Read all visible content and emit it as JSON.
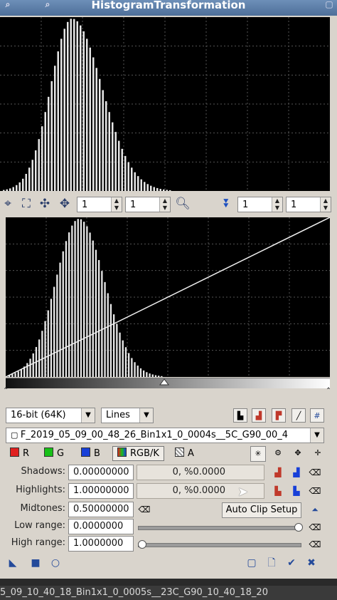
{
  "window": {
    "title": "HistogramTransformation"
  },
  "toolbar": {
    "zoom_h_1": "1",
    "zoom_v_1": "1",
    "zoom_h_2": "1",
    "zoom_v_2": "1"
  },
  "options": {
    "resolution": "16-bit (64K)",
    "graph_style": "Lines"
  },
  "view": {
    "selected": "F_2019_05_09_00_48_26_Bin1x1_0_0004s__5C_G90_00_4"
  },
  "channels": {
    "r": "R",
    "g": "G",
    "b": "B",
    "rgbk": "RGB/K",
    "a": "A"
  },
  "params": {
    "shadows_label": "Shadows:",
    "shadows_value": "0.00000000",
    "shadows_clip": "0, %0.0000",
    "highlights_label": "Highlights:",
    "highlights_value": "1.00000000",
    "highlights_clip": "0, %0.0000",
    "midtones_label": "Midtones:",
    "midtones_value": "0.50000000",
    "auto_clip_label": "Auto Clip Setup",
    "low_range_label": "Low range:",
    "low_range_value": "0.0000000",
    "high_range_label": "High range:",
    "high_range_value": "1.0000000"
  },
  "taskbar": {
    "text": "5_09_10_40_18_Bin1x1_0_0005s__23C_G90_10_40_18_20"
  },
  "colors": {
    "title_bg": "#5a7ba6",
    "panel_bg": "#d9d4cc",
    "histogram_bg": "#000000",
    "accent": "#244a9a"
  }
}
